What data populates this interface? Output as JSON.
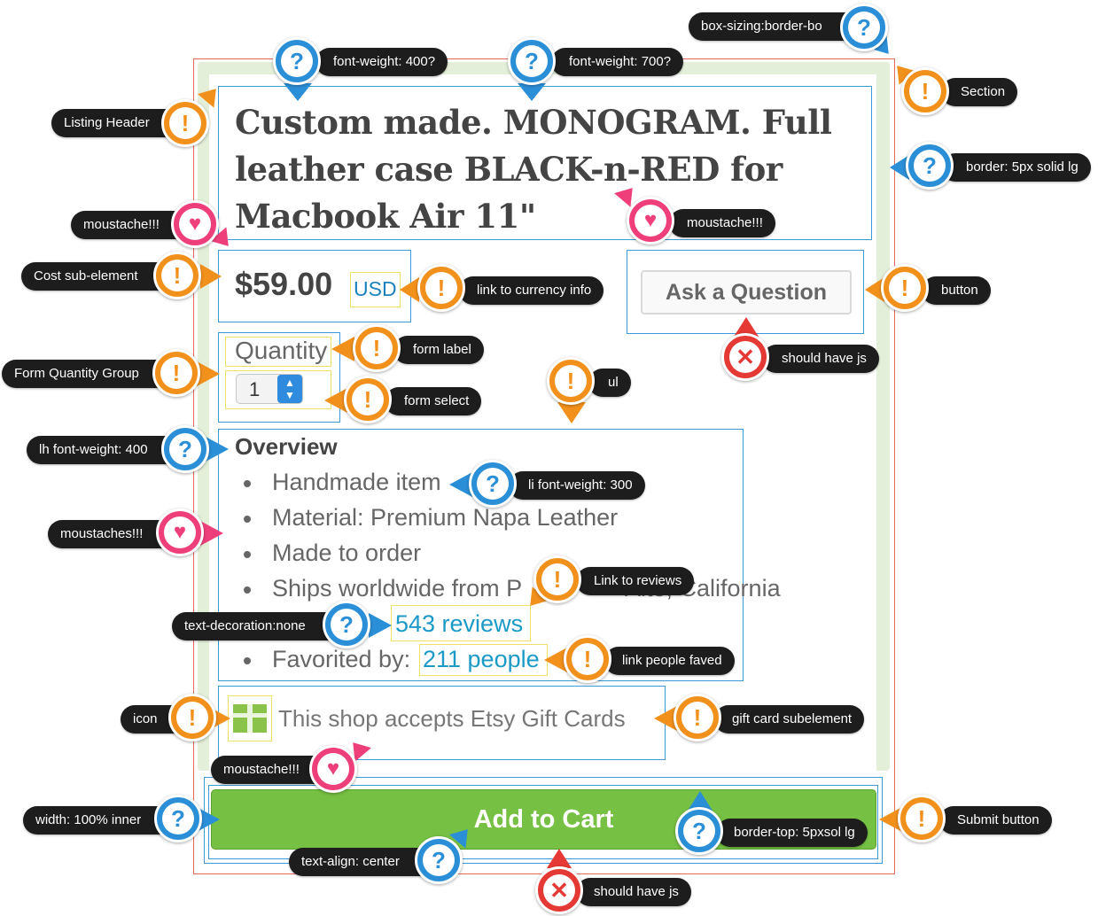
{
  "listing": {
    "title": "Custom made. MONOGRAM. Full leather case BLACK-n-RED for Macbook Air 11\"",
    "price": "$59.00",
    "currency": "USD",
    "ask_button": "Ask a Question",
    "quantity_label": "Quantity",
    "quantity_value": "1",
    "overview_heading": "Overview",
    "overview_items": [
      "Handmade item",
      "Material: Premium Napa Leather",
      "Made to order",
      "Ships worldwide from P",
      "Alto, California"
    ],
    "reviews_link": "543 reviews",
    "favorited_prefix": "Favorited by: ",
    "favorited_link": "211 people",
    "gift_text": "This shop accepts Etsy Gift Cards",
    "add_to_cart": "Add to Cart"
  },
  "colors": {
    "accent_green": "#76c043",
    "section_green": "#e3efd9",
    "link_blue": "#1b9ac8",
    "question_badge": "#2b8fd8",
    "warning_badge": "#f2901c",
    "heart_badge": "#ee3f7a",
    "error_badge": "#e53935"
  },
  "annotations": [
    {
      "label": "box-sizing:border-bo",
      "type": "question"
    },
    {
      "label": "font-weight: 400?",
      "type": "question"
    },
    {
      "label": "font-weight: 700?",
      "type": "question"
    },
    {
      "label": "Section",
      "type": "warning"
    },
    {
      "label": "Listing Header",
      "type": "warning"
    },
    {
      "label": "border: 5px solid lg",
      "type": "question"
    },
    {
      "label": "moustache!!!",
      "type": "heart"
    },
    {
      "label": "moustache!!!",
      "type": "heart"
    },
    {
      "label": "Cost sub-element",
      "type": "warning"
    },
    {
      "label": "link to currency info",
      "type": "warning"
    },
    {
      "label": "button",
      "type": "warning"
    },
    {
      "label": "should have js",
      "type": "error"
    },
    {
      "label": "form label",
      "type": "warning"
    },
    {
      "label": "Form Quantity Group",
      "type": "warning"
    },
    {
      "label": "form select",
      "type": "warning"
    },
    {
      "label": "ul",
      "type": "warning"
    },
    {
      "label": "lh font-weight: 400",
      "type": "question"
    },
    {
      "label": "li font-weight: 300",
      "type": "question"
    },
    {
      "label": "moustaches!!!",
      "type": "heart"
    },
    {
      "label": "Link to reviews",
      "type": "warning"
    },
    {
      "label": "text-decoration:none",
      "type": "question"
    },
    {
      "label": "link people faved",
      "type": "warning"
    },
    {
      "label": "icon",
      "type": "warning"
    },
    {
      "label": "gift card subelement",
      "type": "warning"
    },
    {
      "label": "moustache!!!",
      "type": "heart"
    },
    {
      "label": "width: 100% inner",
      "type": "question"
    },
    {
      "label": "Submit button",
      "type": "warning"
    },
    {
      "label": "border-top: 5pxsol lg",
      "type": "question"
    },
    {
      "label": "text-align: center",
      "type": "question"
    },
    {
      "label": "should have js",
      "type": "error"
    }
  ],
  "badge_glyphs": {
    "question": "?",
    "warning": "!",
    "heart": "♥",
    "error": "✕"
  }
}
